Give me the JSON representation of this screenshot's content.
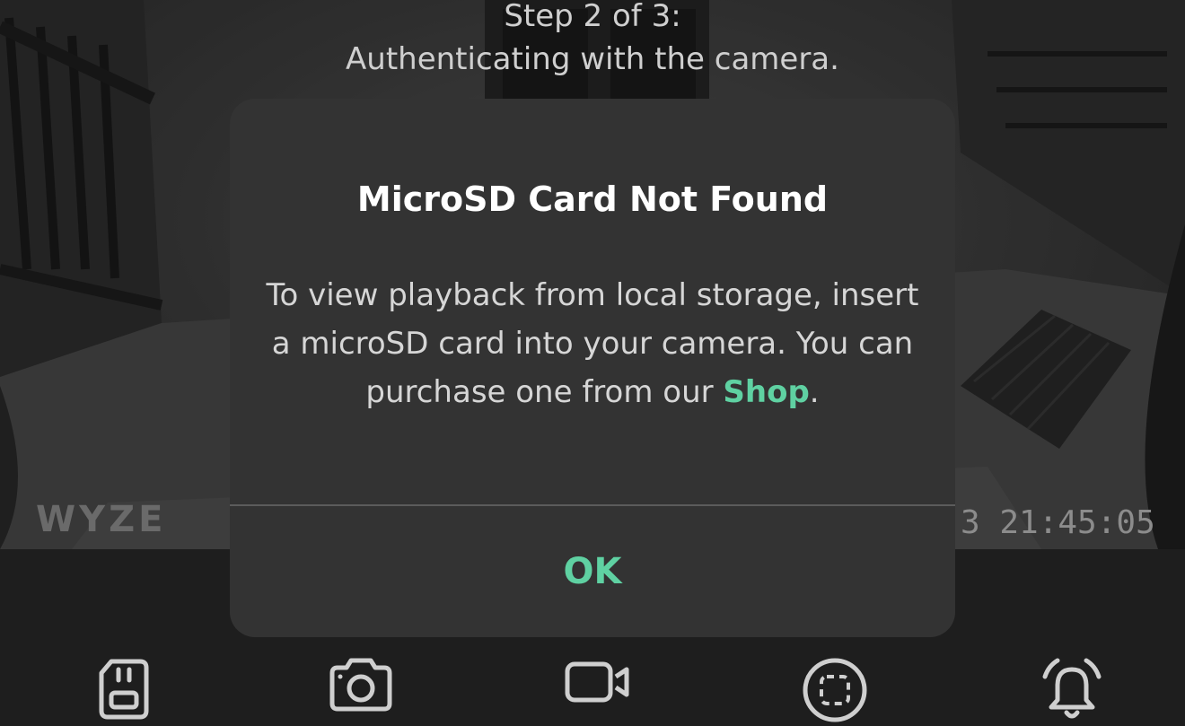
{
  "feed": {
    "step_label": "Step 2 of 3:",
    "step_description": "Authenticating with the camera.",
    "watermark": "WYZE",
    "timestamp": "3 21:45:05"
  },
  "dialog": {
    "title": "MicroSD Card Not Found",
    "body_text": "To view playback from local storage, insert a microSD card into your camera. You can purchase one from our",
    "link_text": "Shop",
    "body_suffix": ".",
    "ok_label": "OK"
  },
  "controls": [
    {
      "icon": "sd-card-icon"
    },
    {
      "icon": "camera-icon"
    },
    {
      "icon": "video-camera-icon"
    },
    {
      "icon": "screen-capture-icon"
    },
    {
      "icon": "alarm-bell-icon"
    }
  ],
  "colors": {
    "accent": "#5fd1a2",
    "dialog_bg": "#333333",
    "control_bar_bg": "#1e1e1e"
  }
}
